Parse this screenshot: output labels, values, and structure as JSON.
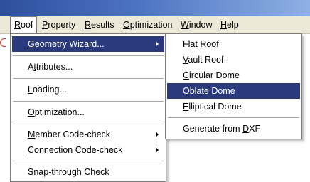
{
  "menubar": {
    "items": [
      {
        "pre": "",
        "u": "R",
        "post": "oof"
      },
      {
        "pre": "",
        "u": "P",
        "post": "roperty"
      },
      {
        "pre": "",
        "u": "R",
        "post": "esults"
      },
      {
        "pre": "",
        "u": "O",
        "post": "ptimization"
      },
      {
        "pre": "",
        "u": "W",
        "post": "indow"
      },
      {
        "pre": "",
        "u": "H",
        "post": "elp"
      }
    ]
  },
  "roof_menu": {
    "items": [
      {
        "pre": "",
        "u": "G",
        "post": "eometry Wizard...",
        "has_submenu": true,
        "highlighted": true
      },
      {
        "pre": "A",
        "u": "t",
        "post": "tributes...",
        "has_submenu": false
      },
      {
        "pre": "",
        "u": "L",
        "post": "oading...",
        "has_submenu": false
      },
      {
        "pre": "",
        "u": "O",
        "post": "ptimization...",
        "has_submenu": false
      },
      {
        "pre": "",
        "u": "M",
        "post": "ember Code-check",
        "has_submenu": true
      },
      {
        "pre": "",
        "u": "C",
        "post": "onnection Code-check",
        "has_submenu": true
      },
      {
        "pre": "S",
        "u": "n",
        "post": "ap-through Check",
        "has_submenu": false
      }
    ]
  },
  "geometry_submenu": {
    "items": [
      {
        "pre": "",
        "u": "F",
        "post": "lat Roof"
      },
      {
        "pre": "",
        "u": "V",
        "post": "ault Roof"
      },
      {
        "pre": "",
        "u": "C",
        "post": "ircular Dome"
      },
      {
        "pre": "",
        "u": "O",
        "post": "blate Dome",
        "highlighted": true
      },
      {
        "pre": "",
        "u": "E",
        "post": "lliptical Dome"
      },
      {
        "pre": "Generate from ",
        "u": "D",
        "post": "XF"
      }
    ]
  },
  "colors": {
    "menu_highlight": "#2b3a7c",
    "menubar_bg": "#ece9d8",
    "titlebar": "#2d4f9c"
  }
}
